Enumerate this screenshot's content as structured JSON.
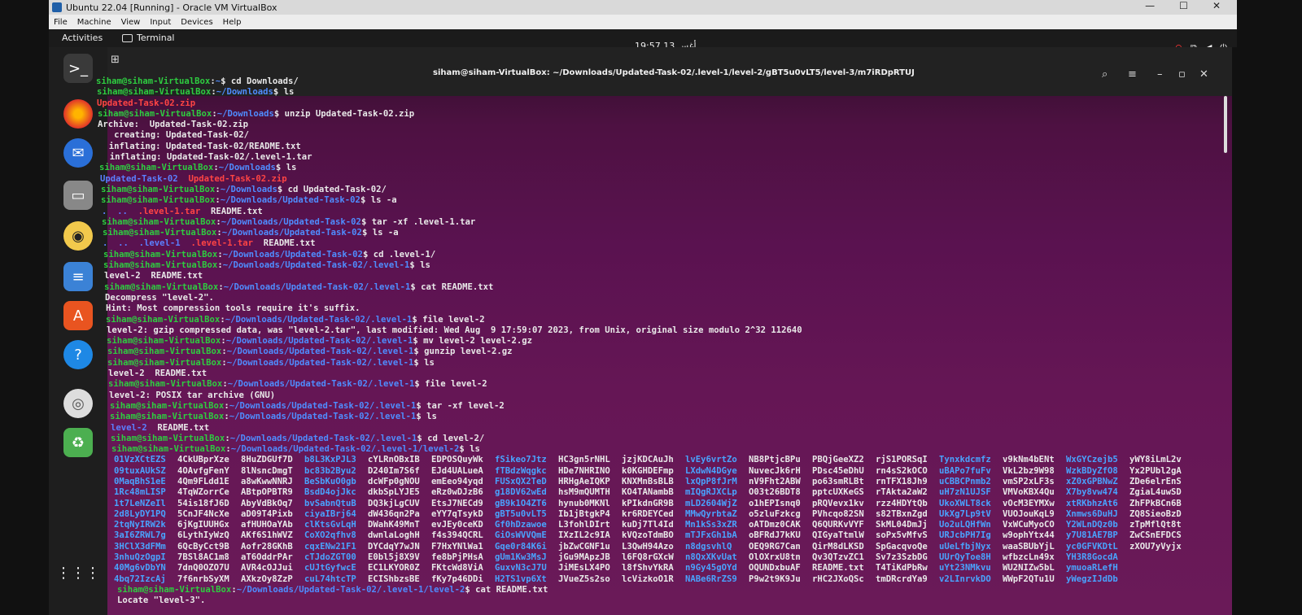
{
  "vbox": {
    "title": "Ubuntu 22.04 [Running] - Oracle VM VirtualBox",
    "menu": [
      "File",
      "Machine",
      "View",
      "Input",
      "Devices",
      "Help"
    ]
  },
  "topbar": {
    "activities": "Activities",
    "app_name": "Terminal",
    "clock": "19:57  أغس 13"
  },
  "terminal": {
    "title": "siham@siham-VirtualBox: ~/Downloads/Updated-Task-02/.level-1/level-2/gBT5u0vLT5/level-3/m7iRDpRTUJ",
    "user": "siham@siham-VirtualBox",
    "lines": [
      {
        "path": "~",
        "cmd": "cd Downloads/"
      },
      {
        "path": "~/Downloads",
        "cmd": "ls"
      },
      {
        "out_red": "Updated-Task-02.zip"
      },
      {
        "path": "~/Downloads",
        "cmd": "unzip Updated-Task-02.zip"
      },
      {
        "out": "Archive:  Updated-Task-02.zip"
      },
      {
        "out": "   creating: Updated-Task-02/"
      },
      {
        "out": "  inflating: Updated-Task-02/README.txt"
      },
      {
        "out": "  inflating: Updated-Task-02/.level-1.tar"
      },
      {
        "path": "~/Downloads",
        "cmd": "ls"
      },
      {
        "out_blue": "Updated-Task-02",
        "out_red": "Updated-Task-02.zip"
      },
      {
        "path": "~/Downloads",
        "cmd": "cd Updated-Task-02/"
      },
      {
        "path": "~/Downloads/Updated-Task-02",
        "cmd": "ls -a"
      },
      {
        "out_blue": ".  ..",
        "out_red": ".level-1.tar",
        "out": "README.txt"
      },
      {
        "path": "~/Downloads/Updated-Task-02",
        "cmd": "tar -xf .level-1.tar"
      },
      {
        "path": "~/Downloads/Updated-Task-02",
        "cmd": "ls -a"
      },
      {
        "out_blue": ".  ..  .level-1",
        "out_red": ".level-1.tar",
        "out": "README.txt"
      },
      {
        "path": "~/Downloads/Updated-Task-02",
        "cmd": "cd .level-1/"
      },
      {
        "path": "~/Downloads/Updated-Task-02/.level-1",
        "cmd": "ls"
      },
      {
        "out": "level-2  README.txt"
      },
      {
        "path": "~/Downloads/Updated-Task-02/.level-1",
        "cmd": "cat README.txt"
      },
      {
        "out": "Decompress \"level-2\"."
      },
      {
        "out": "Hint: Most compression tools require it's suffix."
      },
      {
        "path": "~/Downloads/Updated-Task-02/.level-1",
        "cmd": "file level-2"
      },
      {
        "out": "level-2: gzip compressed data, was \"level-2.tar\", last modified: Wed Aug  9 17:59:07 2023, from Unix, original size modulo 2^32 112640"
      },
      {
        "path": "~/Downloads/Updated-Task-02/.level-1",
        "cmd": "mv level-2 level-2.gz"
      },
      {
        "path": "~/Downloads/Updated-Task-02/.level-1",
        "cmd": "gunzip level-2.gz"
      },
      {
        "path": "~/Downloads/Updated-Task-02/.level-1",
        "cmd": "ls"
      },
      {
        "out": "level-2  README.txt"
      },
      {
        "path": "~/Downloads/Updated-Task-02/.level-1",
        "cmd": "file level-2"
      },
      {
        "out": "level-2: POSIX tar archive (GNU)"
      },
      {
        "path": "~/Downloads/Updated-Task-02/.level-1",
        "cmd": "tar -xf level-2"
      },
      {
        "path": "~/Downloads/Updated-Task-02/.level-1",
        "cmd": "ls"
      },
      {
        "out_blue": "level-2",
        "out": "README.txt"
      },
      {
        "path": "~/Downloads/Updated-Task-02/.level-1",
        "cmd": "cd level-2/"
      },
      {
        "path": "~/Downloads/Updated-Task-02/.level-1/level-2",
        "cmd": "ls"
      }
    ],
    "listing": [
      [
        "01VzXCtEZS",
        "4CkUBprXze",
        "8HuZDGUf7D",
        "b8L3KxPJL3",
        "cYLRnOBxIB",
        "EDPOSQuyWk",
        "fSikeo7Jtz",
        "HC3gn5rNHL",
        "jzjKDCAuJh",
        "lvEy6vrtZo",
        "NB8PtjcBPu",
        "PBQjGeeXZ2",
        "rjS1PORSqI",
        "Tynxkdcmfz",
        "v9kNm4bENt",
        "WxGYCzejb5",
        "yWY8iLmL2v"
      ],
      [
        "09tuxAUkSZ",
        "4OAvfgFenY",
        "8lNsncDmgT",
        "bc83b2Byu2",
        "D240Im7S6f",
        "EJd4UALueA",
        "fTBdzWqgkc",
        "HDe7NHRINO",
        "k0KGHDEFmp",
        "LXdwN4DGye",
        "NuvecJk6rH",
        "PDsc45eDhU",
        "rn4sS2kOCO",
        "uBAPo7fuFv",
        "VkL2bz9W98",
        "WzkBDyZfO8",
        "Yx2PUbl2gA"
      ],
      [
        "0MaqBhS1eE",
        "4Qm9FLdd1E",
        "a8wKwwNNRJ",
        "BeSbKuO0gb",
        "dcWFp0gNOU",
        "emEeo94yqd",
        "FUSxQX2TeD",
        "HRHgAeIQKP",
        "KNXMnBsBLB",
        "lxQpP8fJrM",
        "nV9Fht2ABW",
        "po63smRLBt",
        "rnTFX18Jh9",
        "uCBBCPnmb2",
        "vmSP2xLF3s",
        "xZ0xGPBNwZ",
        "ZDe6elrEnS"
      ],
      [
        "1Rc48mLISP",
        "4TqWZorrCe",
        "ABtpOPBTR9",
        "BsdD4ojJkc",
        "dkbSpLYJE5",
        "eRz0wDJzB6",
        "g18DV62wEd",
        "hsM9mQUMTH",
        "KO4TANambB",
        "mIQgRJXCLp",
        "O03t26BDT8",
        "pptcUXKeGS",
        "rTAkta2aW2",
        "uH7zN1UJSF",
        "VMVoKBX4Qu",
        "X7by8vw474",
        "ZgiaL4uwSD"
      ],
      [
        "1t7LeNZeIl",
        "54is18fJ6D",
        "AbyVdBkOq7",
        "bvSabnQtuB",
        "DQ3kjLgCUV",
        "EtsJ7NECd9",
        "gB9k1O4ZT6",
        "hynub0MKNl",
        "kPIkdnGR9B",
        "mLD2604WjZ",
        "o1hEPIsnq0",
        "pRQVevx1kv",
        "rzz4HDYtQb",
        "UkoXWLT8ck",
        "vOcM3EYMXw",
        "xtRKbhzAt6",
        "ZhFPkBCn6B"
      ],
      [
        "2d8LyDY1PQ",
        "5CnJF4NcXe",
        "aD09T4Pixb",
        "ciyaIBrj64",
        "dW436qn2Pa",
        "eYY7qTsykD",
        "gBT5u0vLT5",
        "Ib1jBtgkP4",
        "kr6RDEYCed",
        "MMwQyrbtaZ",
        "o5zluFzkcg",
        "PVhcqo82SN",
        "s82TBxnZgd",
        "UkXg7Lp9tV",
        "VUOJouKqL9",
        "Xnmws6DuHJ",
        "ZQ8SieoBzD"
      ],
      [
        "2tqNyIRW2k",
        "6jKgIUUHGx",
        "afHUHOaYAb",
        "clKtsGvLqH",
        "DWahK49MnT",
        "evJEy0ceKD",
        "Gf0hDzawoe",
        "L3fohlDIrt",
        "kuDj7Tl4Id",
        "Mn1kSs3xZR",
        "oATDmz0CAK",
        "Q6QURKvVYF",
        "SkML04DmJj",
        "Uo2uLQHfWn",
        "VxWCuMyoCO",
        "Y2WLnDQz0b",
        "zTpMflQt8t"
      ],
      [
        "3aI6ZRWL7g",
        "6LythIyWzQ",
        "AKf6S1hWVZ",
        "CoXO2qfhv8",
        "dwnlaLoghH",
        "f4s394QCRL",
        "GiOsWVVQmE",
        "IXzIL2c9IA",
        "kVQzoTdmBO",
        "mTJFxGh1bA",
        "oBFRdJ7kKU",
        "QIGyaTtmlW",
        "soPx5vMfvS",
        "URJcbPH7Ig",
        "w9ophYtx44",
        "y7U81AE7BP",
        "ZwCSnEFDCS"
      ],
      [
        "3HClX3dFMm",
        "6QcByCct9B",
        "Aofr28GKhB",
        "cqxENw21F1",
        "DYCdqY7wJN",
        "F7HxYNlWa1",
        "Gqe0r84K6i",
        "jbZwCGNF1u",
        "L3QwH94Azo",
        "n8dgsvhlQ",
        "OEQ9RG7Can",
        "QirM8dLKSD",
        "SpGacqvoQe",
        "uUeLfbjNyx",
        "waaSBUbYjL",
        "yc0GFVKDtL",
        "zXOU7yVyjx"
      ],
      [
        "3nhuQzOgpI",
        "7BSl8AC1m8",
        "aT6OddrPAr",
        "cTJdoZGT00",
        "E0bl5j8X9V",
        "fe8bPjPHsA",
        "gUm1Kw3MsJ",
        "jGu9MApzJB",
        "l6FQ8rGXcW",
        "n8QxXKvUat",
        "OlOXrxU8tn",
        "Qv3QTzvZC1",
        "Sv7z3SzbDG",
        "UUrQyToe8H",
        "wfbzcLn49x",
        "YH3R8GocdA",
        ""
      ],
      [
        "40Mg6vDbYN",
        "7dnQ0OZO7U",
        "AVR4cOJJui",
        "cUJtGyfwcE",
        "EC1LKYOR0Z",
        "FKtcWd8ViA",
        "GuxvN3cJ7U",
        "JiMEsLX4PO",
        "l8fShvYkRA",
        "n9Gy45gOYd",
        "OQUNDxbuAF",
        "README.txt",
        "T4TiKdPbRw",
        "uYt23NMkvu",
        "WU2NIZw5bL",
        "ymuoaRLefH",
        ""
      ],
      [
        "4bq72IzcAj",
        "7f6nrbSyXM",
        "AXkzOy8ZzP",
        "cuL74htcTP",
        "ECIShbzsBE",
        "fKy7p46DDi",
        "H2TS1vp6Xt",
        "JVueZ5s2so",
        "lcVizkoO1R",
        "NABe6RrZS9",
        "P9w2t9K9Ju",
        "rHC2JXoQSc",
        "tmDRcrdYa9",
        "v2LInrvkDO",
        "WWpF2QTu1U",
        "yWegzIJdDb",
        ""
      ]
    ],
    "listing_colors": [
      "cyan",
      "plain",
      "plain",
      "cyan",
      "plain",
      "plain",
      "cyan",
      "plain",
      "plain",
      "cyan",
      "plain",
      "plain",
      "plain",
      "cyan",
      "plain",
      "cyan",
      "plain"
    ],
    "last_prompt_path": "~/Downloads/Updated-Task-02/.level-1/level-2",
    "last_cmd": "cat README.txt",
    "last_out": "Locate \"level-3\"."
  }
}
